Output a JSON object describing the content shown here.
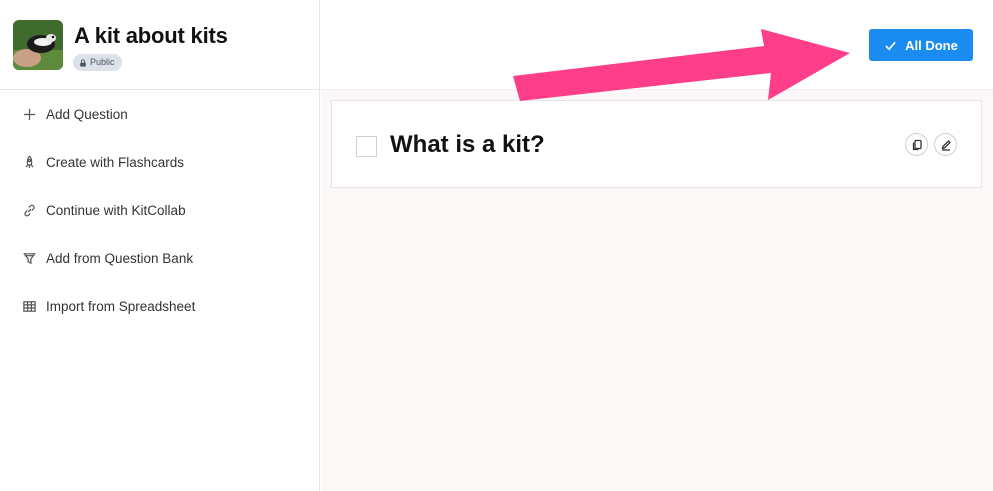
{
  "kit": {
    "title": "A kit about kits",
    "visibility": "Public",
    "thumbnail_icon": "kit-fox-photo"
  },
  "sidebar": {
    "items": [
      {
        "label": "Add Question",
        "icon": "plus-icon"
      },
      {
        "label": "Create with Flashcards",
        "icon": "rocket-icon"
      },
      {
        "label": "Continue with KitCollab",
        "icon": "link-icon"
      },
      {
        "label": "Add from Question Bank",
        "icon": "funnel-icon"
      },
      {
        "label": "Import from Spreadsheet",
        "icon": "table-icon"
      }
    ]
  },
  "toolbar": {
    "done_label": "All Done",
    "done_icon": "check-icon"
  },
  "questions": [
    {
      "text": "What is a kit?",
      "checked": false
    }
  ],
  "colors": {
    "accent": "#1a8cf0",
    "annotation_arrow": "#ff3e8a",
    "main_bg": "#fcf8f8"
  }
}
